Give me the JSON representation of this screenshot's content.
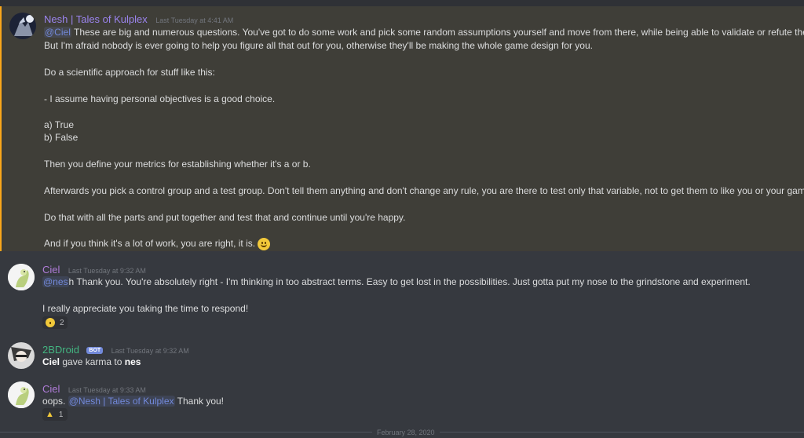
{
  "colors": {
    "background": "#36393f",
    "highlight": "#3f3e38",
    "highlight_bar": "#faa61a",
    "mention": "#7289da",
    "nesh_name": "#9b84ee",
    "ciel_name": "#b07cd8",
    "bot_name": "#43b581"
  },
  "messages": [
    {
      "author": "Nesh | Tales of Kulplex",
      "timestamp": "Last Tuesday at 4:41 AM",
      "mention": "@Ciel",
      "lines": [
        "These are big and numerous questions. You've got to do some work and pick some random assumptions yourself and move from there, while being able to validate or refute them.",
        "But I'm afraid nobody is ever going to help you figure all that out for you, otherwise they'll be making the whole game design for you.",
        "Do a scientific approach for stuff like this:",
        "- I assume having personal objectives is a good choice.",
        "a) True",
        "b) False",
        "Then you define your metrics for establishing whether it's a or b.",
        "Afterwards you pick a control group and a test group. Don't tell them anything and don't change any rule, you are there to test only that variable, not to get them to like you or your game.",
        "Do that with all the parts and put together and test that and continue until you're happy.",
        "And if you think it's a lot of work, you are right, it is."
      ],
      "emoji_icon": "slight-smile-emoji"
    },
    {
      "author": "Ciel",
      "timestamp": "Last Tuesday at 9:32 AM",
      "mention": "@nes",
      "mention_tail": "h",
      "lines": [
        "Thank you. You're absolutely right - I'm thinking in too abstract terms. Easy to get lost in the possibilities. Just gotta put my nose to the grindstone and experiment.",
        "I really appreciate you taking the time to respond!"
      ],
      "reaction": {
        "icon": "grinning-emoji",
        "count": "2"
      }
    },
    {
      "author": "2BDroid",
      "bot_tag": "BOT",
      "timestamp": "Last Tuesday at 9:32 AM",
      "giver": "Ciel",
      "action": "gave karma to",
      "receiver": "nes"
    },
    {
      "author": "Ciel",
      "timestamp": "Last Tuesday at 9:33 AM",
      "prefix": "oops.",
      "mention": "@Nesh | Tales of Kulplex",
      "suffix": "Thank you!",
      "reaction": {
        "icon": "thumbs-up-emoji",
        "count": "1"
      }
    }
  ],
  "date_divider": "February 28, 2020"
}
